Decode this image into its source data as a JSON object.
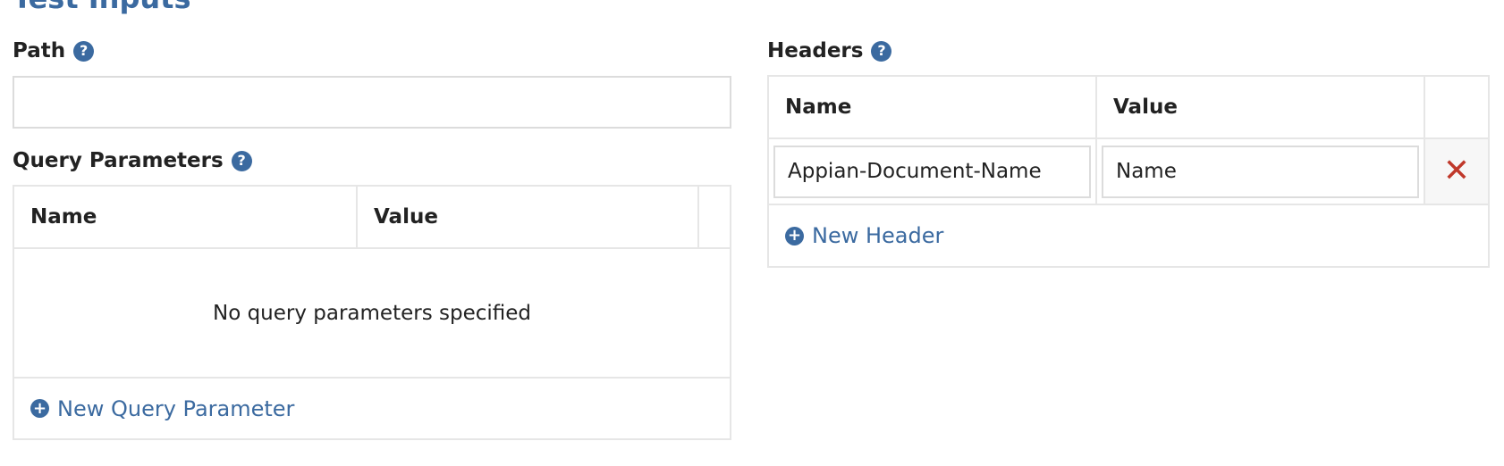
{
  "section_title": "Test Inputs",
  "path": {
    "label": "Path",
    "help_icon": "question-circle-icon",
    "value": "",
    "placeholder": ""
  },
  "query_parameters": {
    "label": "Query Parameters",
    "help_icon": "question-circle-icon",
    "columns": [
      "Name",
      "Value"
    ],
    "empty_message": "No query parameters specified",
    "add_label": "New Query Parameter",
    "add_icon": "plus-circle-icon"
  },
  "headers": {
    "label": "Headers",
    "help_icon": "question-circle-icon",
    "columns": [
      "Name",
      "Value"
    ],
    "rows": [
      {
        "name": "Appian-Document-Name",
        "value": "Name",
        "remove_icon": "close-icon"
      }
    ],
    "add_label": "New Header",
    "add_icon": "plus-circle-icon"
  },
  "colors": {
    "accent": "#3b6aa0",
    "remove": "#c0392b",
    "border": "#e6e6e6"
  }
}
